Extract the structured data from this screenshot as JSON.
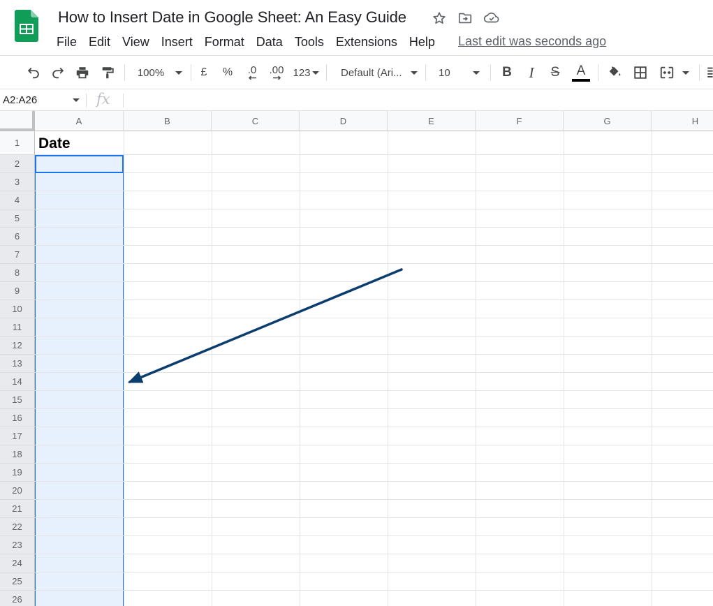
{
  "document": {
    "title": "How to Insert Date in Google Sheet: An Easy Guide",
    "last_edit": "Last edit was seconds ago"
  },
  "menu": [
    "File",
    "Edit",
    "View",
    "Insert",
    "Format",
    "Data",
    "Tools",
    "Extensions",
    "Help"
  ],
  "toolbar": {
    "zoom": "100%",
    "currency": "£",
    "percent": "%",
    "decrease_decimal": ".0",
    "increase_decimal": ".00",
    "more_formats": "123",
    "font": "Default (Ari...",
    "font_size": "10",
    "bold": "B",
    "italic": "I",
    "strikethrough": "S",
    "text_color": "A"
  },
  "formula_bar": {
    "name_box": "A2:A26",
    "fx": "fx",
    "formula": ""
  },
  "grid": {
    "columns": [
      "A",
      "B",
      "C",
      "D",
      "E",
      "F",
      "G",
      "H"
    ],
    "rows": [
      "1",
      "2",
      "3",
      "4",
      "5",
      "6",
      "7",
      "8",
      "9",
      "10",
      "11",
      "12",
      "13",
      "14",
      "15",
      "16",
      "17",
      "18",
      "19",
      "20",
      "21",
      "22",
      "23",
      "24",
      "25",
      "26"
    ],
    "cells": {
      "A1": "Date"
    },
    "selection": "A2:A26",
    "active_cell": "A2"
  },
  "colors": {
    "selection_border": "#1a73e8",
    "selection_fill": "#e7f0fd",
    "arrow": "#0b3d6e",
    "sheets_green": "#0f9d58"
  }
}
